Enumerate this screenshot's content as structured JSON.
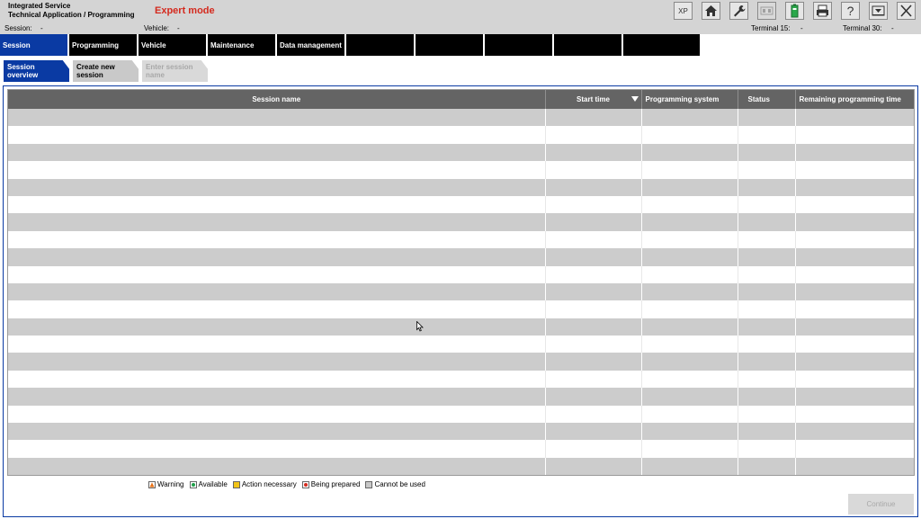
{
  "header": {
    "title_line1": "Integrated Service",
    "title_line2": "Technical Application / Programming",
    "mode": "Expert mode",
    "toolbar": {
      "xp_label": "XP",
      "icons": [
        "xp-icon",
        "home-icon",
        "wrench-icon",
        "display-icon",
        "battery-icon",
        "printer-icon",
        "help-icon",
        "minimize-icon",
        "close-icon"
      ]
    }
  },
  "info": {
    "session_label": "Session:",
    "session_value": "-",
    "vehicle_label": "Vehicle:",
    "vehicle_value": "-",
    "terminal15_label": "Terminal 15:",
    "terminal15_value": "-",
    "terminal30_label": "Terminal 30:",
    "terminal30_value": "-"
  },
  "main_nav": {
    "tabs": [
      {
        "label": "Session",
        "active": true
      },
      {
        "label": "Programming"
      },
      {
        "label": "Vehicle"
      },
      {
        "label": "Maintenance"
      },
      {
        "label": "Data management"
      },
      {
        "label": ""
      },
      {
        "label": ""
      },
      {
        "label": ""
      },
      {
        "label": ""
      },
      {
        "label": ""
      }
    ]
  },
  "sub_nav": {
    "tabs": [
      {
        "label": "Session overview",
        "state": "active"
      },
      {
        "label": "Create new session",
        "state": "normal"
      },
      {
        "label": "Enter session name",
        "state": "disabled"
      }
    ]
  },
  "table": {
    "columns": [
      "Session name",
      "Start time",
      "Programming system",
      "Status",
      "Remaining programming time"
    ],
    "sorted_column": "Start time",
    "row_count": 21
  },
  "legend": {
    "items": [
      {
        "label": "Warning",
        "icon": "warning-icon",
        "color": "#e8731a"
      },
      {
        "label": "Available",
        "icon": "available-icon",
        "color": "#1fa04a"
      },
      {
        "label": "Action necessary",
        "icon": "action-necessary-icon",
        "color": "#f2c418"
      },
      {
        "label": "Being prepared",
        "icon": "being-prepared-icon",
        "color": "#d42a1e"
      },
      {
        "label": "Cannot be used",
        "icon": "cannot-be-used-icon",
        "color": "#8a8a8a"
      }
    ]
  },
  "footer": {
    "continue_label": "Continue"
  },
  "colors": {
    "accent": "#0a3aa3",
    "mode_text": "#d42a1e",
    "header_bg": "#d4d4d4",
    "table_header_bg": "#646464"
  }
}
